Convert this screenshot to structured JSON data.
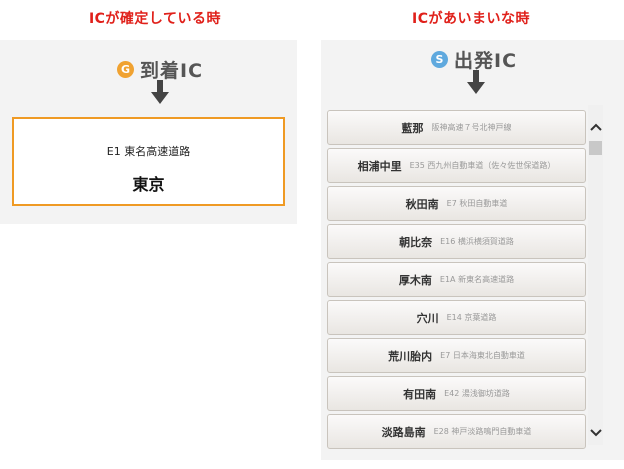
{
  "confirmed_section": {
    "heading": "ICが確定している時",
    "ic_label": "到着IC",
    "badge_letter": "G",
    "road": "E1 東名高速道路",
    "name": "東京"
  },
  "ambiguous_section": {
    "heading": "ICがあいまいな時",
    "ic_label": "出発IC",
    "badge_letter": "S",
    "items": [
      {
        "name": "藍那",
        "road": "阪神高速７号北神戸線"
      },
      {
        "name": "相浦中里",
        "road": "E35 西九州自動車道（佐々佐世保道路）"
      },
      {
        "name": "秋田南",
        "road": "E7 秋田自動車道"
      },
      {
        "name": "朝比奈",
        "road": "E16 横浜横須賀道路"
      },
      {
        "name": "厚木南",
        "road": "E1A 新東名高速道路"
      },
      {
        "name": "穴川",
        "road": "E14 京葉道路"
      },
      {
        "name": "荒川胎内",
        "road": "E7 日本海東北自動車道"
      },
      {
        "name": "有田南",
        "road": "E42 湯浅御坊道路"
      },
      {
        "name": "淡路島南",
        "road": "E28 神戸淡路鳴門自動車道"
      }
    ]
  },
  "colors": {
    "heading": "#e0201a",
    "confirmed_border": "#ef9a24",
    "badge_g": "#f0a231",
    "badge_s": "#5fa9de",
    "panel_bg": "#f3f3f3"
  }
}
